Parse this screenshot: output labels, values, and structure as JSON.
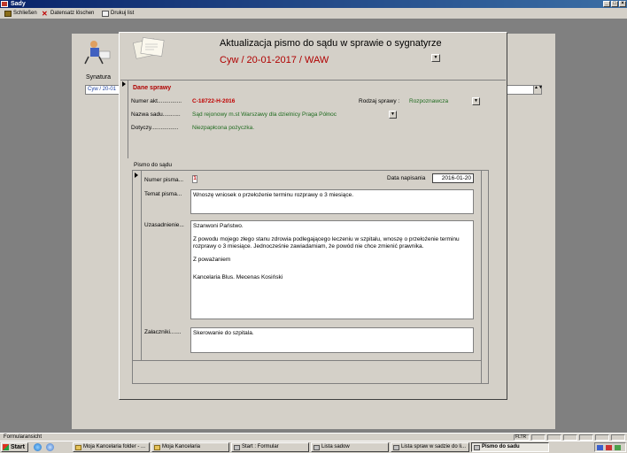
{
  "window": {
    "title": "Sady",
    "minimize": "_",
    "restore": "□",
    "close": "×"
  },
  "toolbar": {
    "close_label": "Schließen",
    "delete_label": "Datensatz löschen",
    "print_label": "Drukuj list"
  },
  "bg_form": {
    "synatura_label": "Synatura",
    "combo_value": "Cyw / 20-01",
    "spin": "▲▼"
  },
  "dialog": {
    "title": "Aktualizacja pismo do sądu w sprawie o sygnatyrze",
    "signature": "Cyw / 20-01-2017 / WAW"
  },
  "case": {
    "section_title": "Dane sprawy",
    "numer_akt_label": "Numer akt...............",
    "numer_akt_value": "C-18722-H-2016",
    "rodzaj_label": "Rodzaj sprawy :",
    "rodzaj_value": "Rozpoznawcza",
    "sad_label": "Nazwa sadu...........",
    "sad_value": "Sąd rejonowy m.st  Warszawy dla dzielnicy Praga Północ",
    "dotyczy_label": "Dotyczy.................",
    "dotyczy_value": "Niezpapłcona pożyczka."
  },
  "letter": {
    "section_title": "Pismo do sądu",
    "numer_label": "Numer pisma...",
    "numer_value": "1",
    "data_label": "Data napisania",
    "data_value": "2016-01-20",
    "temat_label": "Temat pisma...",
    "temat_value": "Wnoszę wniosek o przełożenie terminu rozprawy o 3 miesiące.",
    "uzasadnienie_label": "Uzasadnienie...",
    "uzasadnienie_lines": [
      "Szanwoni Państwo.",
      "Z powodu mojego złego stanu zdrowia podlegającego leczeniu w szpitalu, wnoszę o przełożenie terminu rozprawy o 3 miesiące. Jednocześnie zawiadamiam, że powód nie chce zmienić prawnika.",
      "Z poważaniem",
      "Kancelaria Blus. Mecenas Kosiński"
    ],
    "zalaczniki_label": "Załaczniki.......",
    "zalaczniki_value": "Skerowanie do szpitala."
  },
  "statusbar": {
    "text": "Formularansicht",
    "mode": "FLTR"
  },
  "taskbar": {
    "start": "Start",
    "tasks": [
      "Moja Kancelaria folder - ...",
      "Moja Kancelaria",
      "Start : Formular",
      "Lista sadow",
      "Lista spraw w sadzie do li...",
      "Pismo do sadu"
    ]
  },
  "colors": {
    "accent_red": "#c00000",
    "value_green": "#1f6b1f",
    "titlebar": "#0a246a"
  },
  "icons": [
    "app-icon",
    "door-icon",
    "delete-x-icon",
    "printer-icon",
    "decor-figure-icon",
    "decor-papers-icon",
    "windows-flag-icon"
  ]
}
